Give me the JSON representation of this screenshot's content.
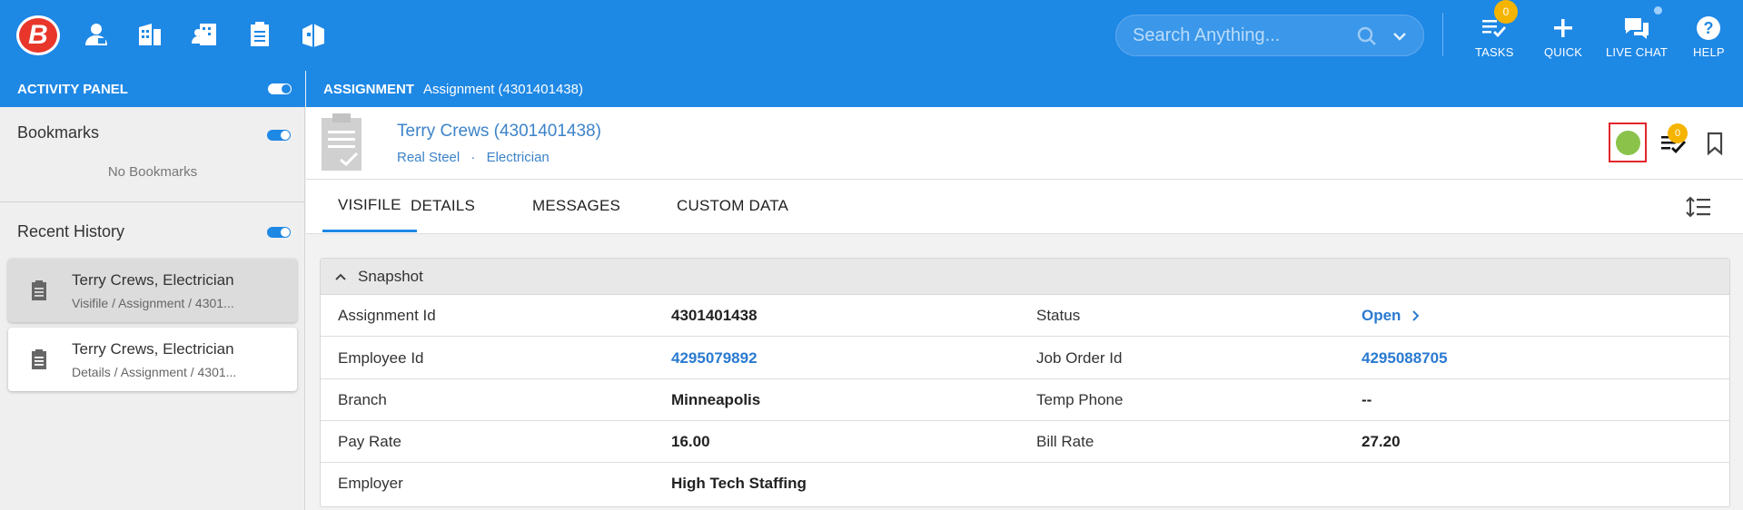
{
  "app": {
    "logo_letter": "B",
    "nav_icons": [
      "candidate-icon",
      "company-icon",
      "contacts-icon",
      "assignment-icon",
      "job-order-icon"
    ],
    "search": {
      "placeholder": "Search Anything..."
    },
    "buttons": {
      "tasks": {
        "label": "TASKS",
        "badge": "0"
      },
      "quick": {
        "label": "QUICK"
      },
      "live_chat": {
        "label": "LIVE CHAT"
      },
      "help": {
        "label": "HELP"
      }
    },
    "brand_color": "#1e88e5"
  },
  "activity_panel": {
    "title": "ACTIVITY PANEL",
    "bookmarks": {
      "title": "Bookmarks",
      "empty_text": "No Bookmarks"
    },
    "recent_history": {
      "title": "Recent History",
      "items": [
        {
          "title": "Terry Crews, Electrician",
          "subtitle": "Visifile / Assignment / 4301..."
        },
        {
          "title": "Terry Crews, Electrician",
          "subtitle": "Details / Assignment / 4301..."
        }
      ]
    }
  },
  "breadcrumb": {
    "section": "ASSIGNMENT",
    "record": "Assignment (4301401438)"
  },
  "record": {
    "title": "Terry Crews (4301401438)",
    "company": "Real Steel",
    "separator": "·",
    "position": "Electrician",
    "status_color": "#8bc34a",
    "tasks_badge": "0"
  },
  "tabs": [
    "VISIFILE",
    "DETAILS",
    "MESSAGES",
    "CUSTOM DATA"
  ],
  "snapshot": {
    "title": "Snapshot",
    "left": [
      {
        "label": "Assignment Id",
        "value": "4301401438"
      },
      {
        "label": "Employee Id",
        "value": "4295079892"
      },
      {
        "label": "Branch",
        "value": "Minneapolis"
      },
      {
        "label": "Pay Rate",
        "value": "16.00"
      },
      {
        "label": "Employer",
        "value": "High Tech Staffing"
      }
    ],
    "right": [
      {
        "label": "Status",
        "value": "Open"
      },
      {
        "label": "Job Order Id",
        "value": "4295088705"
      },
      {
        "label": "Temp Phone",
        "value": "--"
      },
      {
        "label": "Bill Rate",
        "value": "27.20"
      }
    ]
  }
}
